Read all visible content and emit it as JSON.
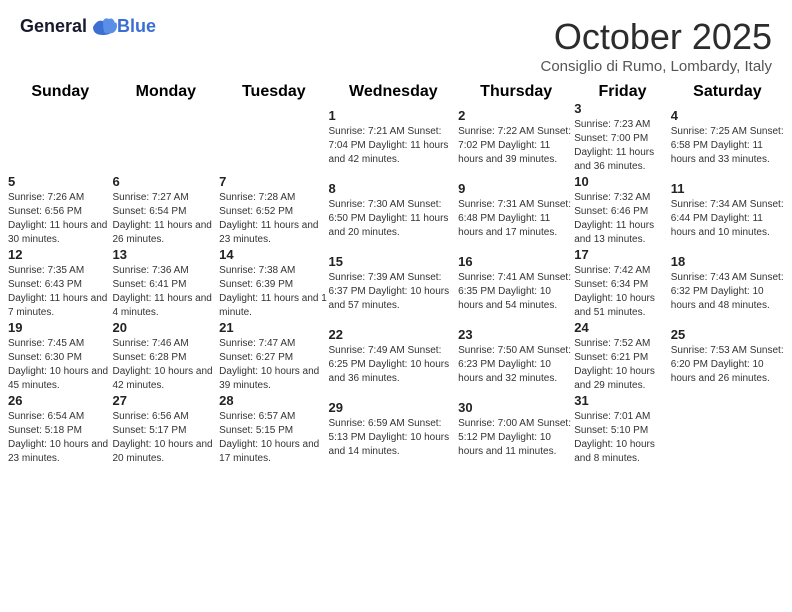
{
  "header": {
    "logo_general": "General",
    "logo_blue": "Blue",
    "title": "October 2025",
    "location": "Consiglio di Rumo, Lombardy, Italy"
  },
  "weekdays": [
    "Sunday",
    "Monday",
    "Tuesday",
    "Wednesday",
    "Thursday",
    "Friday",
    "Saturday"
  ],
  "weeks": [
    [
      {
        "day": "",
        "info": ""
      },
      {
        "day": "",
        "info": ""
      },
      {
        "day": "",
        "info": ""
      },
      {
        "day": "1",
        "info": "Sunrise: 7:21 AM\nSunset: 7:04 PM\nDaylight: 11 hours\nand 42 minutes."
      },
      {
        "day": "2",
        "info": "Sunrise: 7:22 AM\nSunset: 7:02 PM\nDaylight: 11 hours\nand 39 minutes."
      },
      {
        "day": "3",
        "info": "Sunrise: 7:23 AM\nSunset: 7:00 PM\nDaylight: 11 hours\nand 36 minutes."
      },
      {
        "day": "4",
        "info": "Sunrise: 7:25 AM\nSunset: 6:58 PM\nDaylight: 11 hours\nand 33 minutes."
      }
    ],
    [
      {
        "day": "5",
        "info": "Sunrise: 7:26 AM\nSunset: 6:56 PM\nDaylight: 11 hours\nand 30 minutes."
      },
      {
        "day": "6",
        "info": "Sunrise: 7:27 AM\nSunset: 6:54 PM\nDaylight: 11 hours\nand 26 minutes."
      },
      {
        "day": "7",
        "info": "Sunrise: 7:28 AM\nSunset: 6:52 PM\nDaylight: 11 hours\nand 23 minutes."
      },
      {
        "day": "8",
        "info": "Sunrise: 7:30 AM\nSunset: 6:50 PM\nDaylight: 11 hours\nand 20 minutes."
      },
      {
        "day": "9",
        "info": "Sunrise: 7:31 AM\nSunset: 6:48 PM\nDaylight: 11 hours\nand 17 minutes."
      },
      {
        "day": "10",
        "info": "Sunrise: 7:32 AM\nSunset: 6:46 PM\nDaylight: 11 hours\nand 13 minutes."
      },
      {
        "day": "11",
        "info": "Sunrise: 7:34 AM\nSunset: 6:44 PM\nDaylight: 11 hours\nand 10 minutes."
      }
    ],
    [
      {
        "day": "12",
        "info": "Sunrise: 7:35 AM\nSunset: 6:43 PM\nDaylight: 11 hours\nand 7 minutes."
      },
      {
        "day": "13",
        "info": "Sunrise: 7:36 AM\nSunset: 6:41 PM\nDaylight: 11 hours\nand 4 minutes."
      },
      {
        "day": "14",
        "info": "Sunrise: 7:38 AM\nSunset: 6:39 PM\nDaylight: 11 hours\nand 1 minute."
      },
      {
        "day": "15",
        "info": "Sunrise: 7:39 AM\nSunset: 6:37 PM\nDaylight: 10 hours\nand 57 minutes."
      },
      {
        "day": "16",
        "info": "Sunrise: 7:41 AM\nSunset: 6:35 PM\nDaylight: 10 hours\nand 54 minutes."
      },
      {
        "day": "17",
        "info": "Sunrise: 7:42 AM\nSunset: 6:34 PM\nDaylight: 10 hours\nand 51 minutes."
      },
      {
        "day": "18",
        "info": "Sunrise: 7:43 AM\nSunset: 6:32 PM\nDaylight: 10 hours\nand 48 minutes."
      }
    ],
    [
      {
        "day": "19",
        "info": "Sunrise: 7:45 AM\nSunset: 6:30 PM\nDaylight: 10 hours\nand 45 minutes."
      },
      {
        "day": "20",
        "info": "Sunrise: 7:46 AM\nSunset: 6:28 PM\nDaylight: 10 hours\nand 42 minutes."
      },
      {
        "day": "21",
        "info": "Sunrise: 7:47 AM\nSunset: 6:27 PM\nDaylight: 10 hours\nand 39 minutes."
      },
      {
        "day": "22",
        "info": "Sunrise: 7:49 AM\nSunset: 6:25 PM\nDaylight: 10 hours\nand 36 minutes."
      },
      {
        "day": "23",
        "info": "Sunrise: 7:50 AM\nSunset: 6:23 PM\nDaylight: 10 hours\nand 32 minutes."
      },
      {
        "day": "24",
        "info": "Sunrise: 7:52 AM\nSunset: 6:21 PM\nDaylight: 10 hours\nand 29 minutes."
      },
      {
        "day": "25",
        "info": "Sunrise: 7:53 AM\nSunset: 6:20 PM\nDaylight: 10 hours\nand 26 minutes."
      }
    ],
    [
      {
        "day": "26",
        "info": "Sunrise: 6:54 AM\nSunset: 5:18 PM\nDaylight: 10 hours\nand 23 minutes."
      },
      {
        "day": "27",
        "info": "Sunrise: 6:56 AM\nSunset: 5:17 PM\nDaylight: 10 hours\nand 20 minutes."
      },
      {
        "day": "28",
        "info": "Sunrise: 6:57 AM\nSunset: 5:15 PM\nDaylight: 10 hours\nand 17 minutes."
      },
      {
        "day": "29",
        "info": "Sunrise: 6:59 AM\nSunset: 5:13 PM\nDaylight: 10 hours\nand 14 minutes."
      },
      {
        "day": "30",
        "info": "Sunrise: 7:00 AM\nSunset: 5:12 PM\nDaylight: 10 hours\nand 11 minutes."
      },
      {
        "day": "31",
        "info": "Sunrise: 7:01 AM\nSunset: 5:10 PM\nDaylight: 10 hours\nand 8 minutes."
      },
      {
        "day": "",
        "info": ""
      }
    ]
  ]
}
